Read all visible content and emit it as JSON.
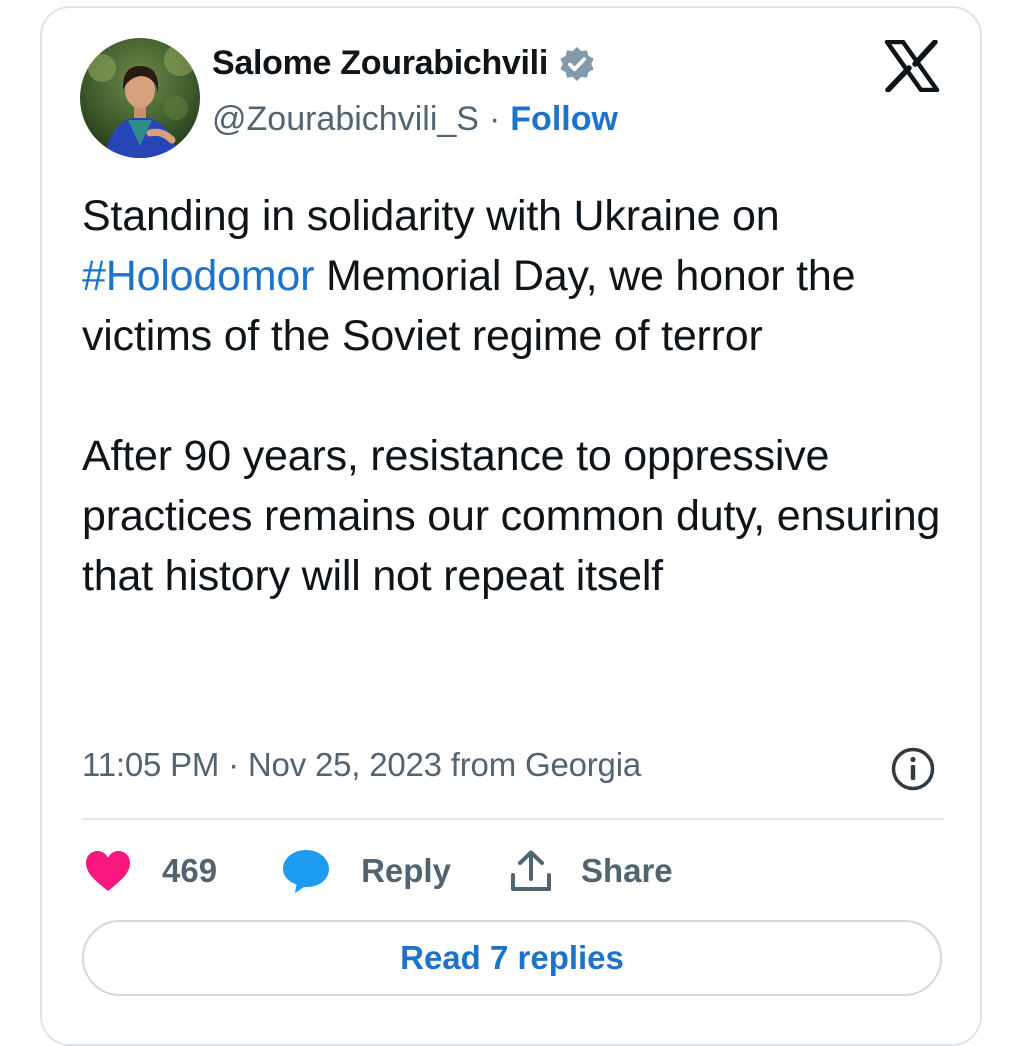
{
  "author": {
    "name": "Salome Zourabichvili",
    "handle": "@Zourabichvili_S",
    "separator": "·",
    "follow_label": "Follow"
  },
  "tweet": {
    "paragraph1_prefix": "Standing in solidarity with Ukraine on ",
    "hashtag": "#Holodomor",
    "paragraph1_suffix": " Memorial Day, we honor the victims of the Soviet regime of terror",
    "paragraph2": "After 90 years, resistance to oppressive practices remains our common duty, ensuring that history will not repeat itself"
  },
  "meta": {
    "timestamp": "11:05 PM · Nov 25, 2023 from Georgia"
  },
  "actions": {
    "like_count": "469",
    "reply_label": "Reply",
    "share_label": "Share"
  },
  "read_replies_label": "Read 7 replies",
  "icons": {
    "verified": "verified-badge-icon",
    "logo": "x-logo-icon",
    "info": "info-icon",
    "like": "heart-icon",
    "reply": "speech-bubble-icon",
    "share": "share-upload-icon"
  },
  "colors": {
    "link_blue": "#1d73c9",
    "like_pink": "#f91880",
    "reply_blue": "#1d9bf0",
    "muted_text": "#536471"
  }
}
